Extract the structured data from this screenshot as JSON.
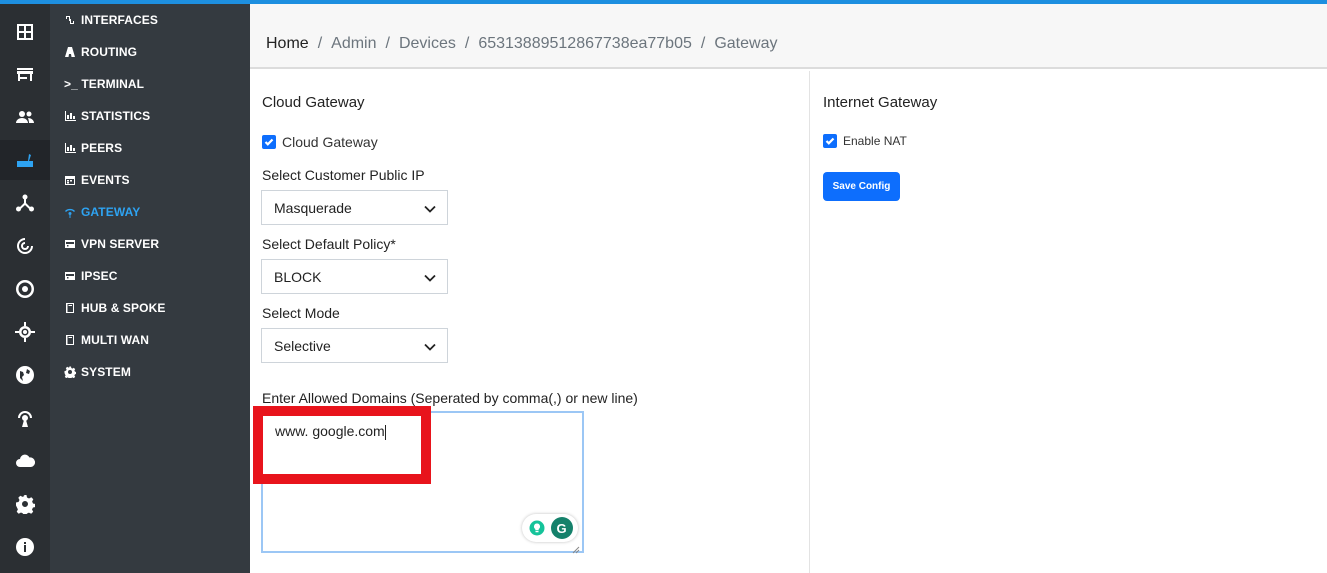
{
  "rail": {
    "icons": [
      "dashboard-icon",
      "store-icon",
      "users-icon",
      "router-icon",
      "network-icon",
      "radar-icon",
      "target-icon",
      "crosshair-icon",
      "globe-icon",
      "broadcast-icon",
      "cloud-icon",
      "settings-icon",
      "info-icon"
    ],
    "active_color": "#2ea3f2"
  },
  "sidebar": {
    "items": [
      {
        "label": "INTERFACES",
        "icon": "link-icon"
      },
      {
        "label": "ROUTING",
        "icon": "road-icon"
      },
      {
        "label": ">_ TERMINAL",
        "icon": ""
      },
      {
        "label": "STATISTICS",
        "icon": "bar-chart-icon"
      },
      {
        "label": "PEERS",
        "icon": "bar-chart-icon"
      },
      {
        "label": "EVENTS",
        "icon": "calendar-icon"
      },
      {
        "label": "GATEWAY",
        "icon": "wifi-icon"
      },
      {
        "label": "VPN SERVER",
        "icon": "server-icon"
      },
      {
        "label": "IPSEC",
        "icon": "server-icon"
      },
      {
        "label": "HUB & SPOKE",
        "icon": "book-icon"
      },
      {
        "label": "MULTI WAN",
        "icon": "book-icon"
      },
      {
        "label": "SYSTEM",
        "icon": "gear-icon"
      }
    ],
    "active_index": 6
  },
  "breadcrumb": {
    "items": [
      "Home",
      "Admin",
      "Devices",
      "65313889512867738ea77b05",
      "Gateway"
    ],
    "separator": "/"
  },
  "cloud_gateway": {
    "title": "Cloud Gateway",
    "checkbox_label": "Cloud Gateway",
    "checked": true,
    "public_ip_label": "Select Customer Public IP",
    "public_ip_value": "Masquerade",
    "policy_label": "Select Default Policy*",
    "policy_value": "BLOCK",
    "mode_label": "Select Mode",
    "mode_value": "Selective",
    "domains_label": "Enter Allowed Domains (Seperated by comma(,) or new line)",
    "domains_value": "www. google.com"
  },
  "internet_gateway": {
    "title": "Internet Gateway",
    "nat_label": "Enable NAT",
    "nat_checked": true,
    "save_label": "Save Config"
  },
  "colors": {
    "accent": "#0d6efd",
    "highlight": "#e8141c",
    "sidebar_bg": "#343a40"
  }
}
